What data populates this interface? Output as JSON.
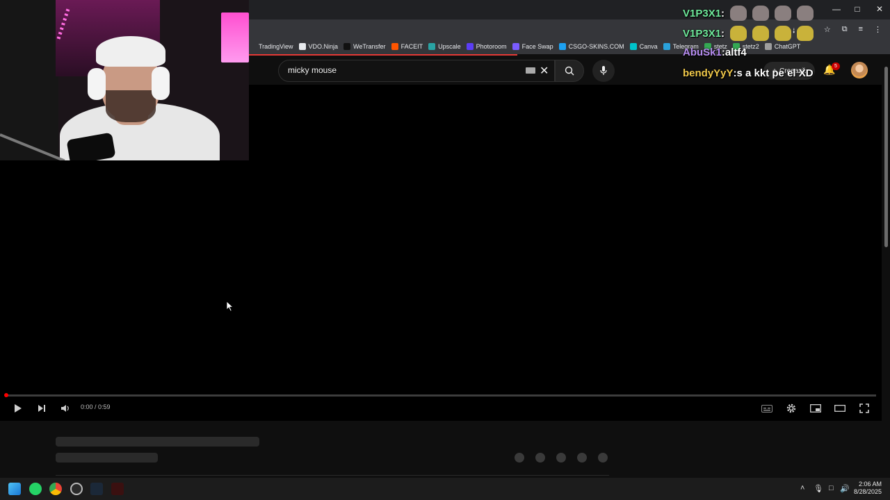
{
  "browser": {
    "window_controls": {
      "minimize": "—",
      "maximize": "□",
      "close": "✕"
    },
    "toolbar_icons": [
      "⭭",
      "⊕",
      "☆",
      "⧉",
      "≡",
      "⋮"
    ],
    "bookmarks": [
      {
        "label": "TradingView",
        "color": "#35363a"
      },
      {
        "label": "VDO.Ninja",
        "color": "#e8eaed"
      },
      {
        "label": "WeTransfer",
        "color": "#111111"
      },
      {
        "label": "FACEIT",
        "color": "#ff5500"
      },
      {
        "label": "Upscale",
        "color": "#29a3a3"
      },
      {
        "label": "Photoroom",
        "color": "#5b3df5"
      },
      {
        "label": "Face Swap",
        "color": "#7a5cff"
      },
      {
        "label": "CSGO-SKINS.COM",
        "color": "#1da1f2"
      },
      {
        "label": "Canva",
        "color": "#00c4cc"
      },
      {
        "label": "Telegram",
        "color": "#2aa1da"
      },
      {
        "label": "stetz",
        "color": "#34a853"
      },
      {
        "label": "stetz2",
        "color": "#34a853"
      },
      {
        "label": "ChatGPT",
        "color": "#9e9e9e"
      }
    ]
  },
  "youtube": {
    "search_value": "micky mouse",
    "create_label": "Creează",
    "notification_count": "5"
  },
  "player": {
    "time_display": "0:00 / 0:59",
    "progress_fraction": 0.0
  },
  "chat": [
    {
      "user": "V1P3X1",
      "sep": " :",
      "message": "",
      "color": "#6ee89a",
      "emotes": [
        "#8a7f7f",
        "#8a7f7f",
        "#8a7f7f",
        "#8a7f7f"
      ]
    },
    {
      "user": "V1P3X1",
      "sep": " :",
      "message": "",
      "color": "#6ee89a",
      "emotes": [
        "#c9b23a",
        "#c9b23a",
        "#c9b23a",
        "#c9b23a"
      ]
    },
    {
      "user": "AbuSk1",
      "sep": " :",
      "message": " altf4",
      "color": "#b68cf0",
      "emotes": []
    },
    {
      "user": "bendyYyY",
      "sep": " :",
      "message": " s a kkt pe el XD",
      "color": "#f0c84a",
      "emotes": []
    }
  ],
  "taskbar": {
    "clock_time": "2:06 AM",
    "clock_date": "8/28/2025",
    "tray_icons": [
      "˄",
      "🎙",
      "□",
      "🔊"
    ]
  },
  "colors": {
    "yt_bg": "#0f0f0f",
    "progress_played": "#ff0000"
  }
}
